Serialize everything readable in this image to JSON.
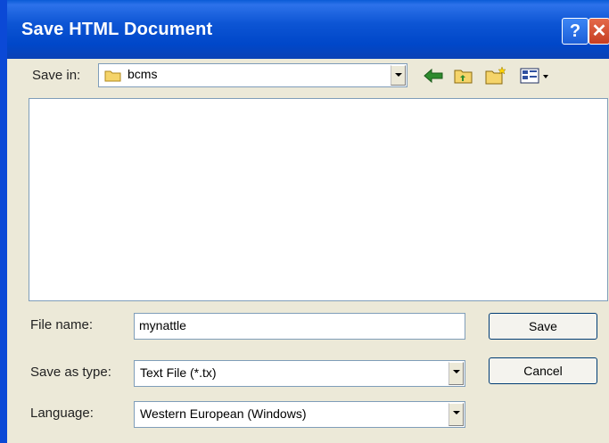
{
  "window": {
    "title": "Save HTML Document",
    "help_glyph": "?",
    "close_glyph": "✕"
  },
  "save_in": {
    "label": "Save in:",
    "value": "bcms"
  },
  "toolbar": {
    "back_icon": "back-arrow-icon",
    "up_icon": "up-folder-icon",
    "new_icon": "new-folder-icon",
    "views_icon": "views-menu-icon"
  },
  "file_name": {
    "label": "File name:",
    "value": "mynattle"
  },
  "save_as_type": {
    "label": "Save as type:",
    "value": "Text File (*.tx)"
  },
  "language": {
    "label": "Language:",
    "value": "Western European (Windows)"
  },
  "buttons": {
    "save": "Save",
    "cancel": "Cancel"
  }
}
